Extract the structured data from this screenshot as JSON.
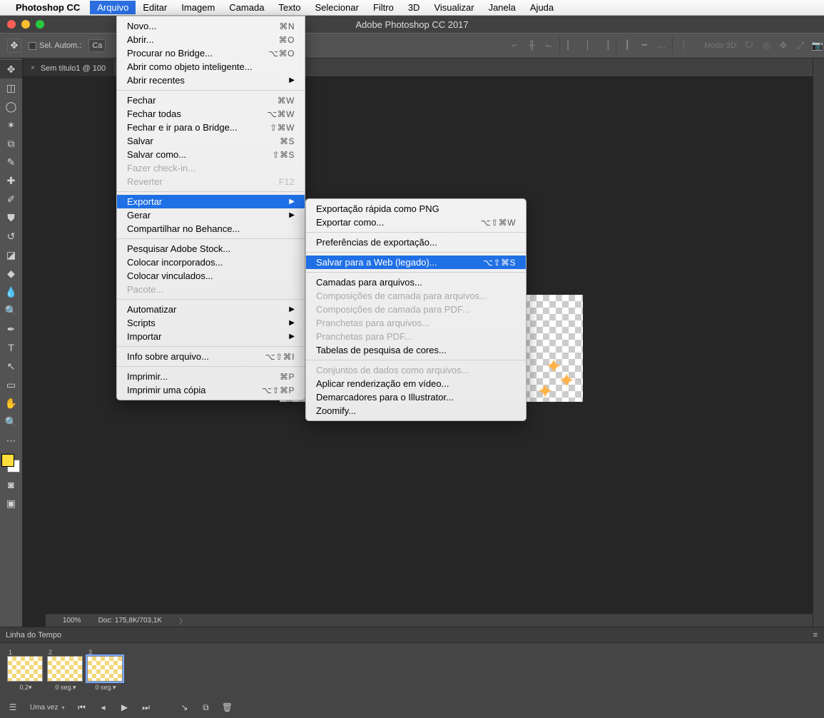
{
  "menubar": {
    "appname": "Photoshop CC",
    "items": [
      "Arquivo",
      "Editar",
      "Imagem",
      "Camada",
      "Texto",
      "Selecionar",
      "Filtro",
      "3D",
      "Visualizar",
      "Janela",
      "Ajuda"
    ],
    "active": "Arquivo"
  },
  "window_title": "Adobe Photoshop CC 2017",
  "optionsbar": {
    "auto_select_label": "Sel. Autom.:",
    "auto_select_dropdown": "Ca",
    "mode3d_label": "Modo 3D:"
  },
  "document_tab": {
    "label": "Sem título1 @ 100",
    "close": "×"
  },
  "status": {
    "zoom": "100%",
    "docinfo": "Doc: 175,8K/703,1K"
  },
  "menu_arquivo": [
    {
      "label": "Novo...",
      "shortcut": "⌘N"
    },
    {
      "label": "Abrir...",
      "shortcut": "⌘O"
    },
    {
      "label": "Procurar no Bridge...",
      "shortcut": "⌥⌘O"
    },
    {
      "label": "Abrir como objeto inteligente..."
    },
    {
      "label": "Abrir recentes",
      "submenu": true
    },
    {
      "sep": true
    },
    {
      "label": "Fechar",
      "shortcut": "⌘W"
    },
    {
      "label": "Fechar todas",
      "shortcut": "⌥⌘W"
    },
    {
      "label": "Fechar e ir para o Bridge...",
      "shortcut": "⇧⌘W"
    },
    {
      "label": "Salvar",
      "shortcut": "⌘S"
    },
    {
      "label": "Salvar como...",
      "shortcut": "⇧⌘S"
    },
    {
      "label": "Fazer check-in...",
      "disabled": true
    },
    {
      "label": "Reverter",
      "shortcut": "F12",
      "disabled": true
    },
    {
      "sep": true
    },
    {
      "label": "Exportar",
      "submenu": true,
      "highlight": true
    },
    {
      "label": "Gerar",
      "submenu": true
    },
    {
      "label": "Compartilhar no Behance..."
    },
    {
      "sep": true
    },
    {
      "label": "Pesquisar Adobe Stock..."
    },
    {
      "label": "Colocar incorporados..."
    },
    {
      "label": "Colocar vinculados..."
    },
    {
      "label": "Pacote...",
      "disabled": true
    },
    {
      "sep": true
    },
    {
      "label": "Automatizar",
      "submenu": true
    },
    {
      "label": "Scripts",
      "submenu": true
    },
    {
      "label": "Importar",
      "submenu": true
    },
    {
      "sep": true
    },
    {
      "label": "Info sobre arquivo...",
      "shortcut": "⌥⇧⌘I"
    },
    {
      "sep": true
    },
    {
      "label": "Imprimir...",
      "shortcut": "⌘P"
    },
    {
      "label": "Imprimir uma cópia",
      "shortcut": "⌥⇧⌘P"
    }
  ],
  "menu_exportar": [
    {
      "label": "Exportação rápida como PNG"
    },
    {
      "label": "Exportar como...",
      "shortcut": "⌥⇧⌘W"
    },
    {
      "sep": true
    },
    {
      "label": "Preferências de exportação..."
    },
    {
      "sep": true
    },
    {
      "label": "Salvar para a Web (legado)...",
      "shortcut": "⌥⇧⌘S",
      "highlight": true
    },
    {
      "sep": true
    },
    {
      "label": "Camadas para arquivos..."
    },
    {
      "label": "Composições de camada para arquivos...",
      "disabled": true
    },
    {
      "label": "Composições de camada para PDF...",
      "disabled": true
    },
    {
      "label": "Pranchetas para arquivos...",
      "disabled": true
    },
    {
      "label": "Pranchetas para PDF...",
      "disabled": true
    },
    {
      "label": "Tabelas de pesquisa de cores..."
    },
    {
      "sep": true
    },
    {
      "label": "Conjuntos de dados como arquivos...",
      "disabled": true
    },
    {
      "label": "Aplicar renderização em vídeo..."
    },
    {
      "label": "Demarcadores para o Illustrator..."
    },
    {
      "label": "Zoomify..."
    }
  ],
  "tools": [
    "move",
    "marquee",
    "lasso",
    "wand",
    "crop",
    "eyedropper",
    "heal",
    "brush",
    "stamp",
    "history",
    "eraser",
    "bucket",
    "blur",
    "dodge",
    "pen",
    "type",
    "arrow",
    "rect",
    "hand",
    "zoom"
  ],
  "timeline": {
    "title": "Linha do Tempo",
    "frames": [
      {
        "n": "1",
        "dur": "0,2▾"
      },
      {
        "n": "2",
        "dur": "0 seg.▾"
      },
      {
        "n": "3",
        "dur": "0 seg.▾",
        "selected": true
      }
    ],
    "loop_label": "Uma vez",
    "controls": [
      "⎋",
      "first",
      "prev",
      "play",
      "next",
      "",
      "tween",
      "dup",
      "trash"
    ]
  }
}
